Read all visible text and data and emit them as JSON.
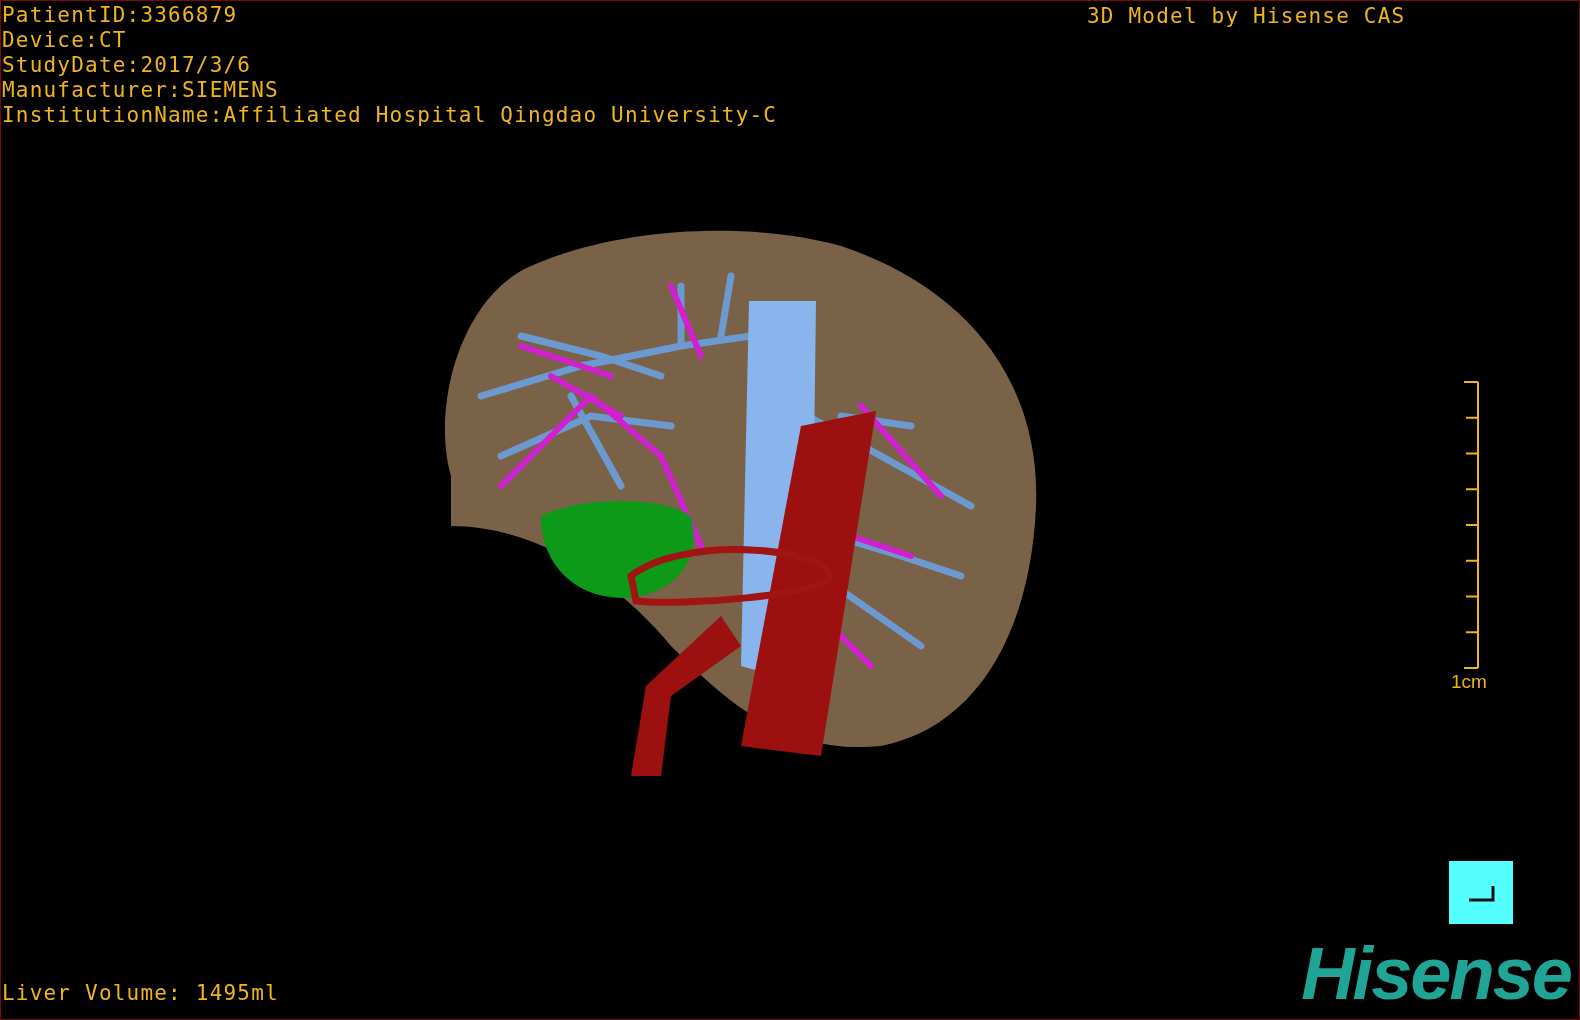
{
  "study_info": [
    "PatientID:3366879",
    "Device:CT",
    "StudyDate:2017/3/6",
    "Manufacturer:SIEMENS",
    "InstitutionName:Affiliated Hospital Qingdao University-C"
  ],
  "credit": "3D Model by Hisense CAS",
  "scale_bar": {
    "label": "1cm"
  },
  "liver_volume": "Liver Volume: 1495ml",
  "logo": "Hisense"
}
